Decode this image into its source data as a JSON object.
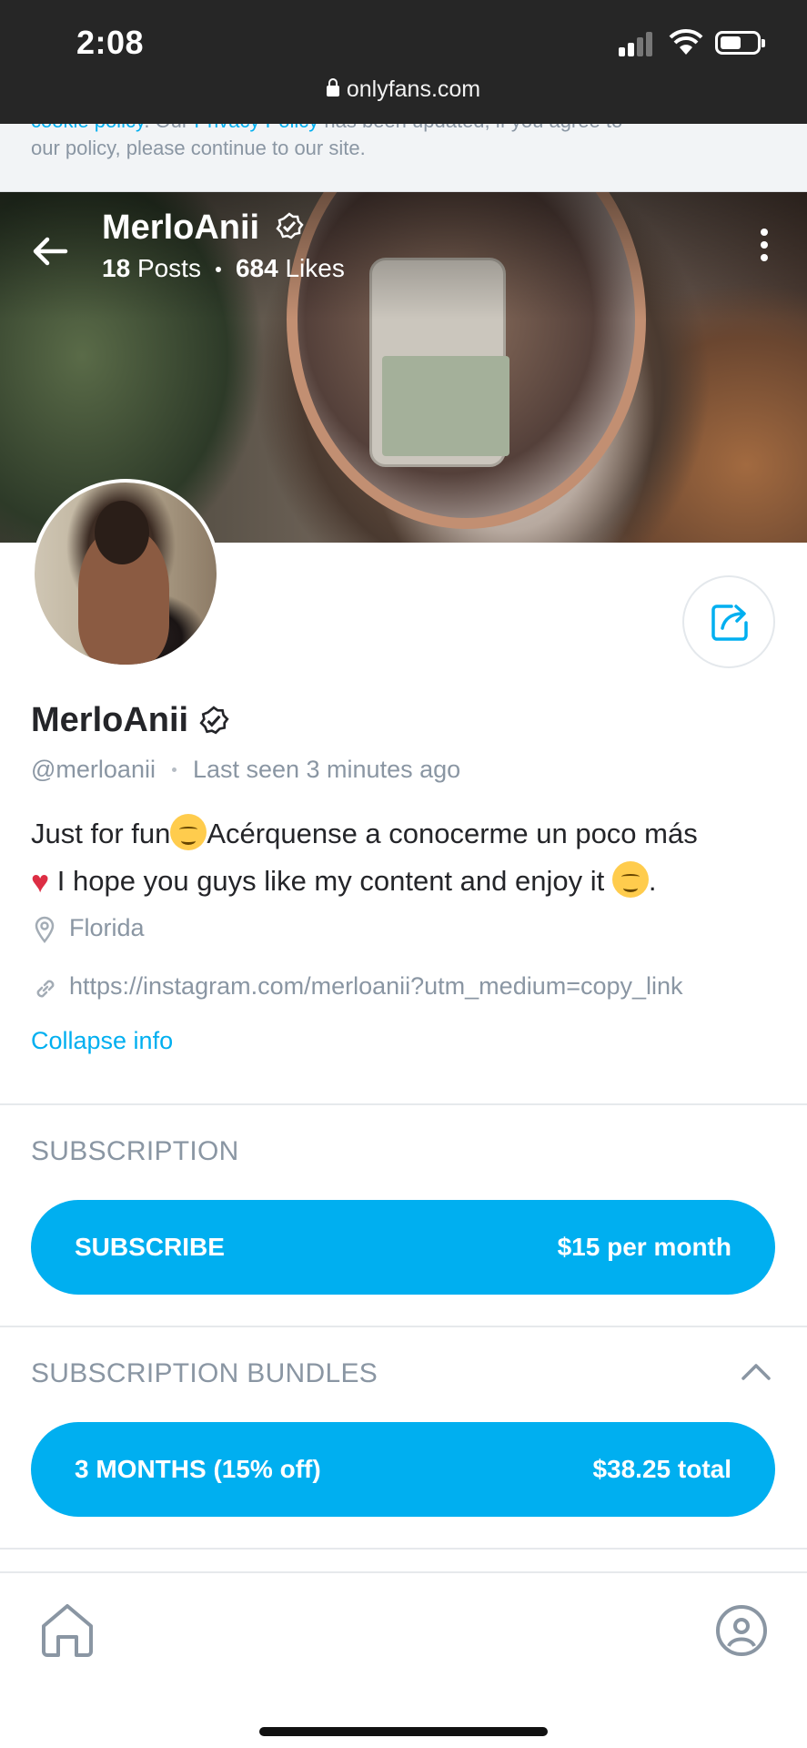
{
  "status_bar": {
    "time": "2:08",
    "url": "onlyfans.com"
  },
  "cookie_banner": {
    "cut_line_link": "cookie policy",
    "cut_line_mid": ". Our ",
    "cut_line_link2": "Privacy Policy",
    "cut_line_rest": " has been updated, if you agree to",
    "text": "our policy, please continue to our site."
  },
  "header": {
    "name": "MerloAnii",
    "posts_count": "18",
    "posts_label": "Posts",
    "likes_count": "684",
    "likes_label": "Likes"
  },
  "profile": {
    "name": "MerloAnii",
    "handle": "@merloanii",
    "last_seen": "Last seen 3 minutes ago",
    "bio_part1": "Just for fun",
    "bio_part2": "Acérquense a conocerme un poco más",
    "bio_part3": " I hope you guys like my content and enjoy it ",
    "bio_end": ".",
    "location": "Florida",
    "website": "https://instagram.com/merloanii?utm_medium=copy_link",
    "collapse_label": "Collapse info"
  },
  "subscription": {
    "label": "SUBSCRIPTION",
    "button_label": "SUBSCRIBE",
    "button_price": "$15 per month"
  },
  "bundles": {
    "label": "SUBSCRIPTION BUNDLES",
    "items": [
      {
        "label": "3 MONTHS (15% off)",
        "price": "$38.25 total"
      }
    ]
  },
  "colors": {
    "accent": "#00aff0",
    "muted": "#8a96a3",
    "statusbar": "#262626"
  },
  "icons": [
    "back-arrow-icon",
    "more-vertical-icon",
    "verified-icon",
    "share-icon",
    "location-pin-icon",
    "link-icon",
    "chevron-up-icon",
    "home-icon",
    "profile-icon"
  ]
}
